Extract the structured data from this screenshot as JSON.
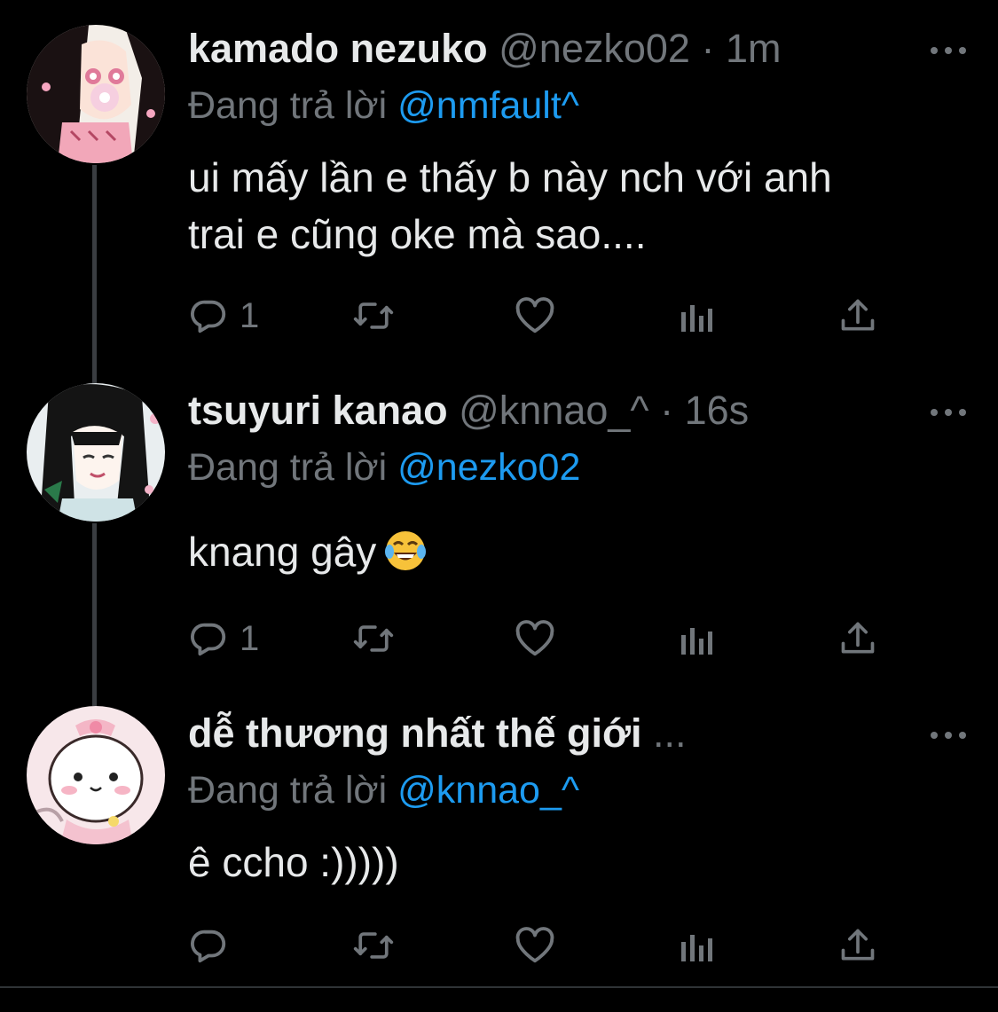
{
  "colors": {
    "background": "#000000",
    "text_primary": "#e7e9ea",
    "text_secondary": "#71767b",
    "mention": "#1d9bf0",
    "thread_line": "#3a3d41"
  },
  "tweets": [
    {
      "display_name": "kamado nezuko",
      "handle": "@nezko02",
      "separator": "·",
      "time": "1m",
      "reply_prefix": "Đang trả lời",
      "reply_to": "@nmfault^",
      "text_lines": [
        "ui mấy lần e thấy b này nch với anh",
        "trai e cũng oke mà sao...."
      ],
      "reply_count": "1",
      "avatar_icon": "nezuko-avatar",
      "actions": [
        "reply-icon",
        "retweet-icon",
        "like-icon",
        "analytics-icon",
        "share-icon"
      ]
    },
    {
      "display_name": "tsuyuri kanao",
      "handle": "@knnao_^",
      "separator": "·",
      "time": "16s",
      "reply_prefix": "Đang trả lời",
      "reply_to": "@nezko02",
      "text": "knang gây",
      "emoji": "face-with-tears-of-joy",
      "reply_count": "1",
      "avatar_icon": "kanao-avatar"
    },
    {
      "display_name": "dễ thương nhất thế giới",
      "truncation": "...",
      "reply_prefix": "Đang trả lời",
      "reply_to": "@knnao_^",
      "text": "ê ccho :)))))",
      "reply_count": "",
      "avatar_icon": "chiikawa-avatar"
    }
  ]
}
